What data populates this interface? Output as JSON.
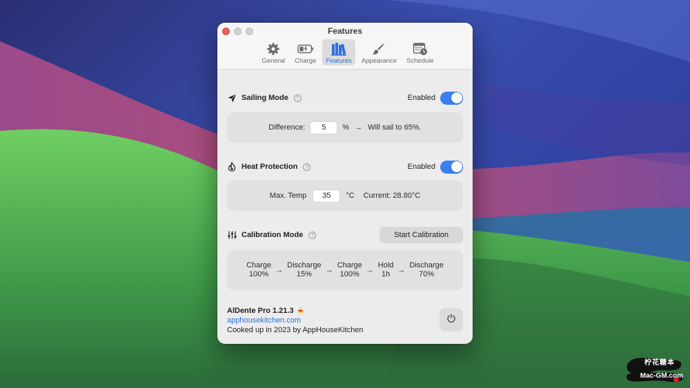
{
  "window": {
    "title": "Features"
  },
  "tabs": [
    {
      "label": "General",
      "icon": "gear-icon",
      "active": false
    },
    {
      "label": "Charge",
      "icon": "battery-icon",
      "active": false
    },
    {
      "label": "Features",
      "icon": "books-icon",
      "active": true
    },
    {
      "label": "Appearance",
      "icon": "paintbrush-icon",
      "active": false
    },
    {
      "label": "Schedule",
      "icon": "calendar-clock-icon",
      "active": false
    }
  ],
  "sailing": {
    "title": "Sailing Mode",
    "help": "?",
    "status": "Enabled",
    "enabled": true,
    "difference_label": "Difference:",
    "difference_value": "5",
    "unit": "%",
    "arrow": "→",
    "result": "Will sail to 65%."
  },
  "heat": {
    "title": "Heat Protection",
    "help": "?",
    "status": "Enabled",
    "enabled": true,
    "max_label": "Max. Temp",
    "max_value": "35",
    "unit": "°C",
    "current": "Current: 28.80°C"
  },
  "calibration": {
    "title": "Calibration Mode",
    "help": "?",
    "button": "Start Calibration",
    "arrow": "→",
    "steps": [
      {
        "line1": "Charge",
        "line2": "100%"
      },
      {
        "line1": "Discharge",
        "line2": "15%"
      },
      {
        "line1": "Charge",
        "line2": "100%"
      },
      {
        "line1": "Hold",
        "line2": "1h"
      },
      {
        "line1": "Discharge",
        "line2": "70%"
      }
    ]
  },
  "footer": {
    "app_name": "AlDente Pro 1.21.3",
    "emoji": "🍝",
    "link": "apphousekitchen.com",
    "credit": "Cooked up in 2023 by AppHouseKitchen"
  },
  "watermark": {
    "top": "柠花糖本",
    "bottom": "Mac-GM.com"
  },
  "colors": {
    "accent": "#3b7ef0",
    "link": "#2f6fe0",
    "close": "#ee5f58"
  }
}
